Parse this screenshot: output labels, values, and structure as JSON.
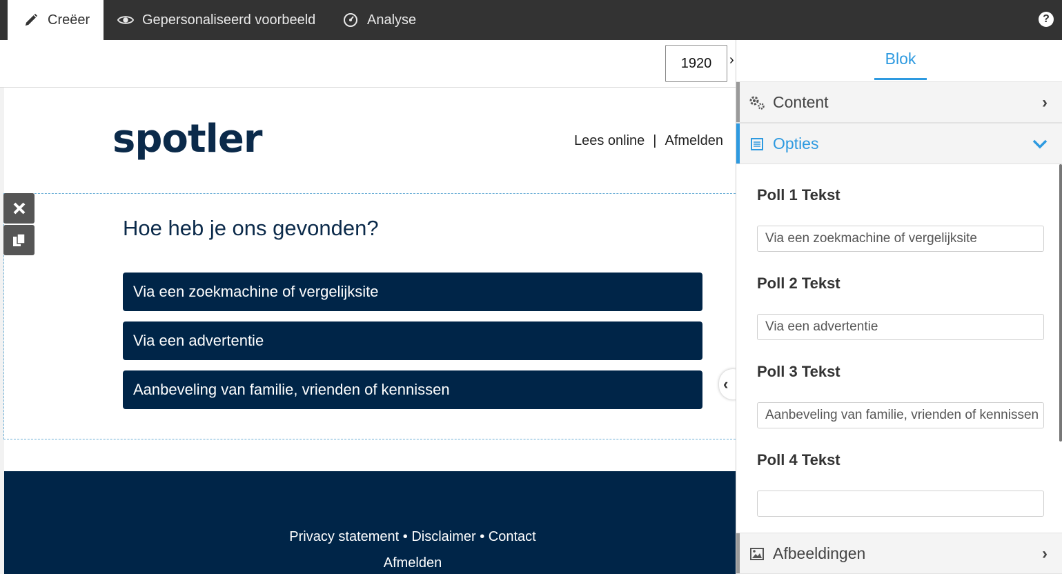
{
  "topbar": {
    "tabs": [
      {
        "label": "Creëer",
        "icon": "pencil-icon"
      },
      {
        "label": "Gepersonaliseerd voorbeeld",
        "icon": "eye-icon"
      },
      {
        "label": "Analyse",
        "icon": "gauge-icon"
      }
    ],
    "help_label": "?"
  },
  "editor": {
    "width_value": "1920"
  },
  "email": {
    "logo_text": "spotler",
    "read_online": "Lees online",
    "separator": "|",
    "unsubscribe_top": "Afmelden",
    "question": "Hoe heb je ons gevonden?",
    "poll_options": [
      "Via een zoekmachine of vergelijksite",
      "Via een advertentie",
      "Aanbeveling van familie, vrienden of kennissen"
    ],
    "footer_links": "Privacy statement • Disclaimer • Contact",
    "footer_unsubscribe": "Afmelden"
  },
  "panel": {
    "tab_label": "Blok",
    "sections": {
      "content": "Content",
      "options": "Opties",
      "images": "Afbeeldingen"
    },
    "fields": [
      {
        "label": "Poll 1 Tekst",
        "value": "Via een zoekmachine of vergelijksite"
      },
      {
        "label": "Poll 2 Tekst",
        "value": "Via een advertentie"
      },
      {
        "label": "Poll 3 Tekst",
        "value": "Aanbeveling van familie, vrienden of kennissen"
      },
      {
        "label": "Poll 4 Tekst",
        "value": ""
      }
    ]
  },
  "colors": {
    "topbar": "#333333",
    "accent": "#2e9ae0",
    "brand_navy": "#002548"
  }
}
